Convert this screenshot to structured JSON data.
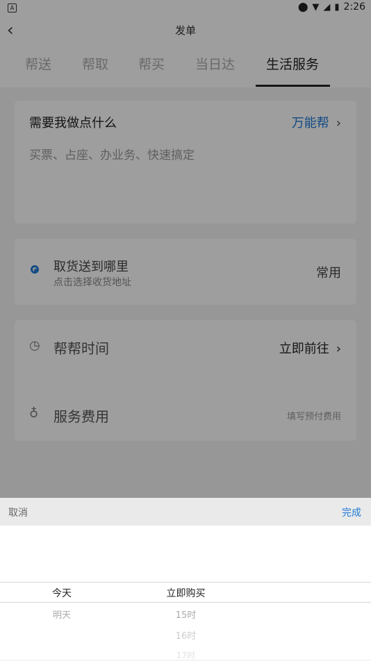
{
  "status_bar": {
    "time": "2:26",
    "left_badge": "A"
  },
  "header": {
    "title": "发单"
  },
  "tabs": [
    {
      "label": "帮送"
    },
    {
      "label": "帮取"
    },
    {
      "label": "帮买"
    },
    {
      "label": "当日达"
    },
    {
      "label": "生活服务"
    }
  ],
  "request_card": {
    "heading": "需要我做点什么",
    "link_label": "万能帮",
    "placeholder": "买票、占座、办业务、快速搞定"
  },
  "address_card": {
    "title": "取货送到哪里",
    "subtitle": "点击选择收货地址",
    "common_label": "常用"
  },
  "details_card": {
    "time_label": "帮帮时间",
    "time_value": "立即前往",
    "fee_label": "服务费用",
    "fee_hint": "填写预付费用"
  },
  "picker": {
    "cancel_label": "取消",
    "done_label": "完成",
    "day_options": [
      "今天",
      "明天"
    ],
    "time_options": [
      "立即购买",
      "15时",
      "16时",
      "17时"
    ]
  },
  "colors": {
    "accent": "#1e7ad6"
  }
}
